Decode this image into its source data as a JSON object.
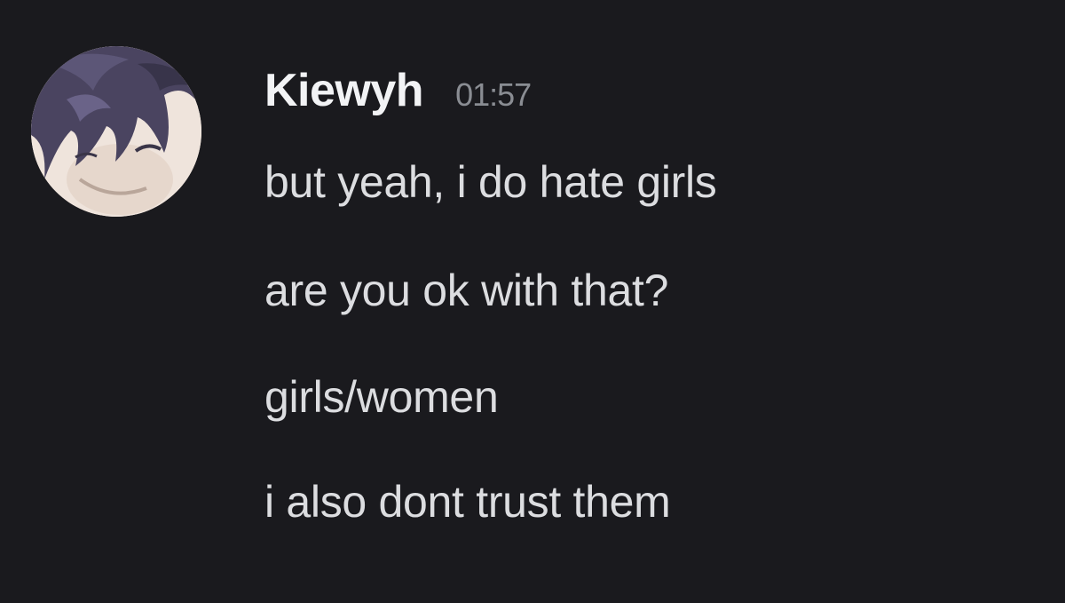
{
  "message": {
    "author": "Kiewyh",
    "timestamp": "01:57",
    "avatar_icon": "anime-character-avatar",
    "lines": [
      "but yeah, i do hate girls",
      "are you ok with that?",
      "girls/women",
      "i also dont trust them"
    ]
  },
  "colors": {
    "background": "#1a1a1e",
    "username": "#f2f3f5",
    "timestamp": "#8a8d93",
    "message_text": "#dcdde0"
  }
}
